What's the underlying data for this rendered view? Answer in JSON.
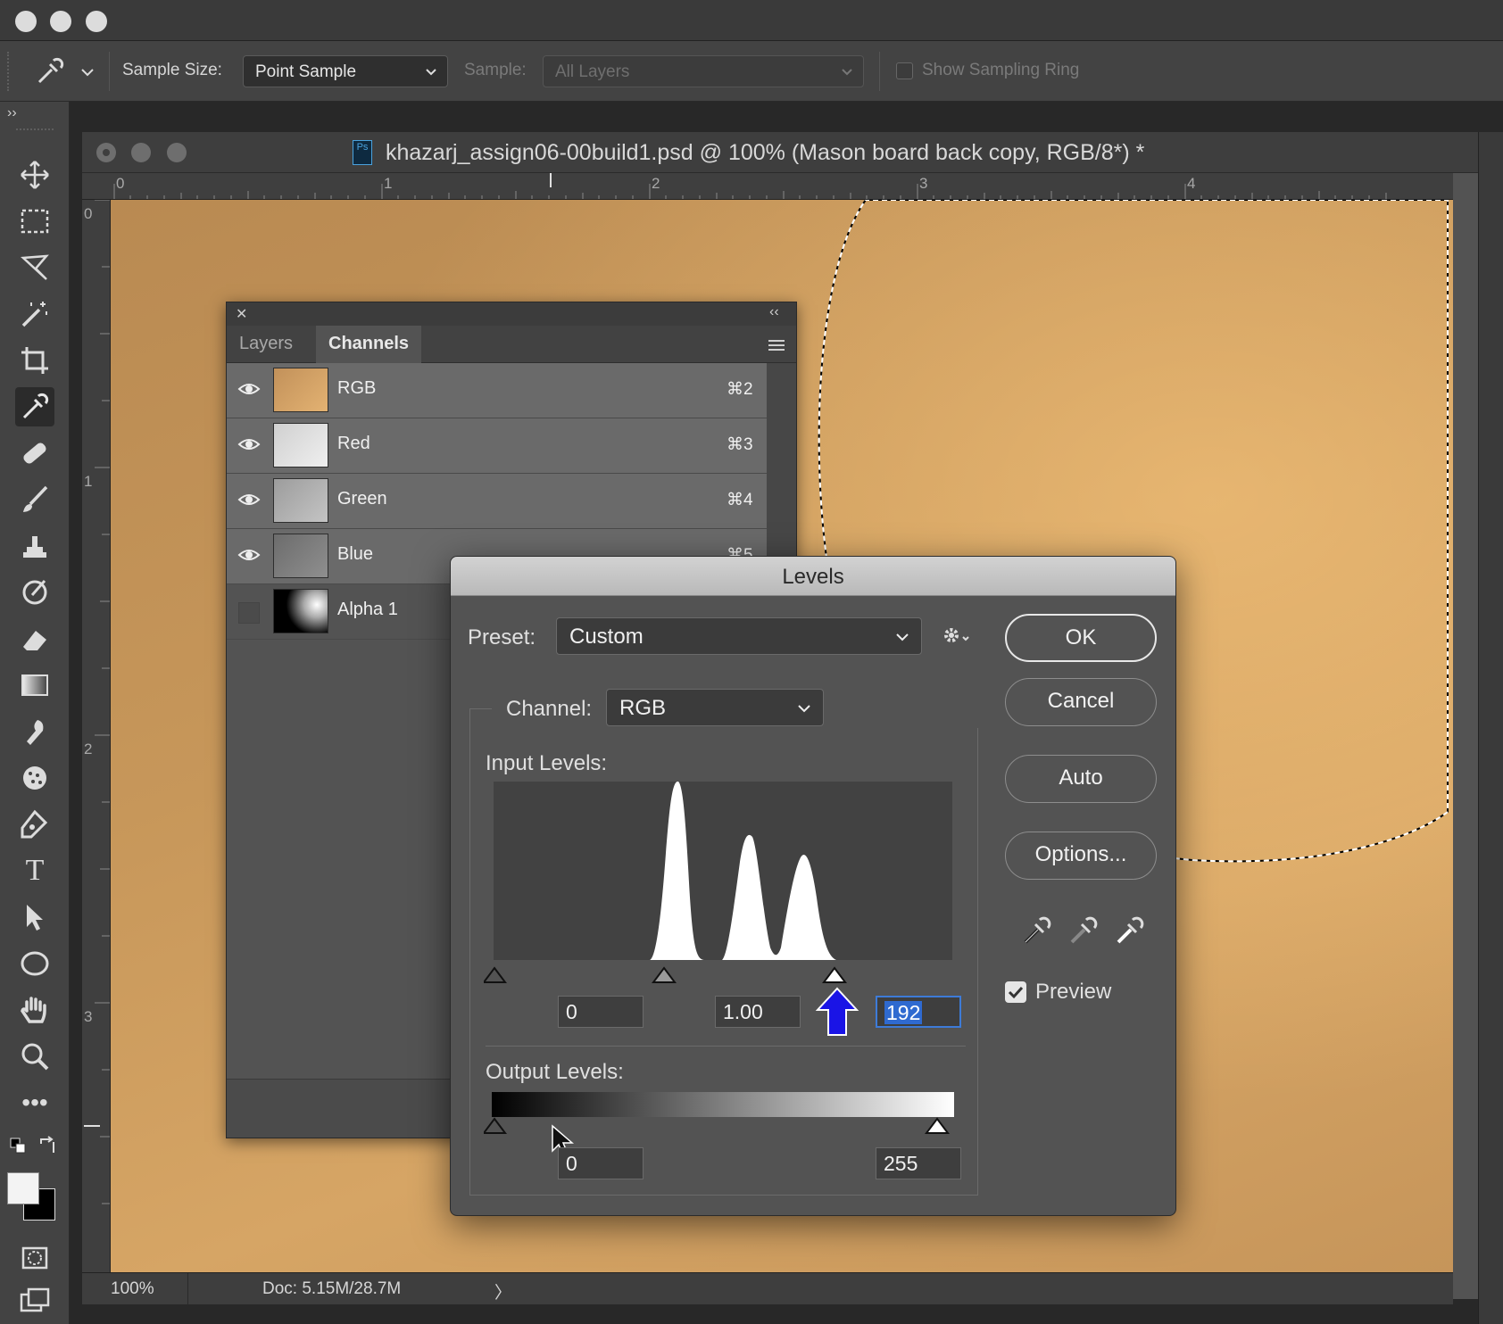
{
  "options_bar": {
    "sample_size_label": "Sample Size:",
    "sample_size_value": "Point Sample",
    "sample_label": "Sample:",
    "sample_value": "All Layers",
    "show_ring_label": "Show Sampling Ring"
  },
  "document": {
    "title": "khazarj_assign06-00build1.psd @ 100% (Mason board back copy, RGB/8*) *",
    "ruler_h": [
      "0",
      "1",
      "2",
      "3",
      "4"
    ],
    "ruler_v": [
      "0",
      "1",
      "2",
      "3"
    ],
    "zoom": "100%",
    "doc_size": "Doc: 5.15M/28.7M",
    "status_arrow": "〉"
  },
  "panel": {
    "tabs": [
      "Layers",
      "Channels"
    ],
    "active_tab": "Channels",
    "channels": [
      {
        "name": "RGB",
        "shortcut": "⌘2"
      },
      {
        "name": "Red",
        "shortcut": "⌘3"
      },
      {
        "name": "Green",
        "shortcut": "⌘4"
      },
      {
        "name": "Blue",
        "shortcut": "⌘5"
      },
      {
        "name": "Alpha 1",
        "shortcut": ""
      }
    ],
    "collapse_glyph": "‹‹",
    "close_glyph": "✕"
  },
  "levels": {
    "title": "Levels",
    "preset_label": "Preset:",
    "preset_value": "Custom",
    "channel_label": "Channel:",
    "channel_value": "RGB",
    "input_label": "Input Levels:",
    "input_black": "0",
    "input_gamma": "1.00",
    "input_white": "192",
    "output_label": "Output Levels:",
    "output_black": "0",
    "output_white": "255",
    "buttons": {
      "ok": "OK",
      "cancel": "Cancel",
      "auto": "Auto",
      "options": "Options..."
    },
    "preview_label": "Preview",
    "preview_checked": true
  },
  "colors": {
    "canvas": "#c7975a",
    "annotation_arrow": "#1a14e6",
    "selection_field": "#2f6ad0"
  }
}
